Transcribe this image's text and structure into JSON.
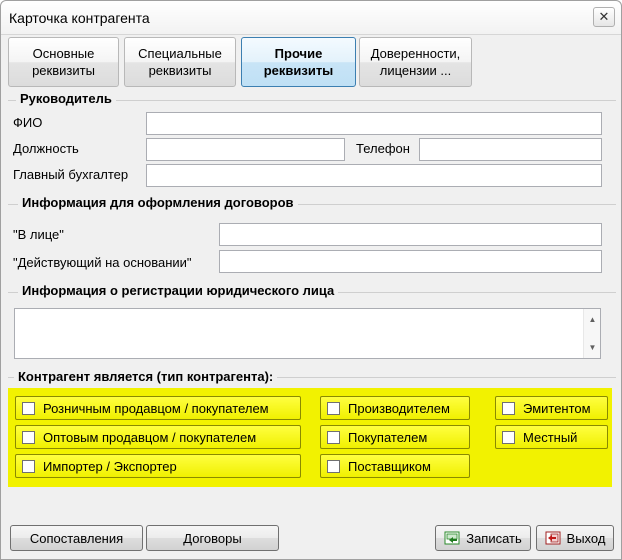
{
  "window": {
    "title": "Карточка контрагента",
    "close_glyph": "✕"
  },
  "tabs": [
    {
      "label": "Основные реквизиты",
      "active": false
    },
    {
      "label": "Специальные реквизиты",
      "active": false
    },
    {
      "label": "Прочие реквизиты",
      "active": true
    },
    {
      "label": "Доверенности, лицензии ...",
      "active": false
    }
  ],
  "director": {
    "section_title": "Руководитель",
    "fio_label": "ФИО",
    "fio_value": "",
    "position_label": "Должность",
    "position_value": "",
    "phone_label": "Телефон",
    "phone_value": "",
    "accountant_label": "Главный бухгалтер",
    "accountant_value": ""
  },
  "contracts": {
    "section_title": "Информация для оформления договоров",
    "in_person_label": "\"В лице\"",
    "in_person_value": "",
    "acting_basis_label": "\"Действующий на основании\"",
    "acting_basis_value": ""
  },
  "registration": {
    "section_title": "Информация о регистрации юридического лица",
    "value": "",
    "scroll_up_glyph": "▲",
    "scroll_down_glyph": "▼"
  },
  "contractor_type": {
    "section_title": "Контрагент является (тип контрагента):",
    "highlight_color": "#f2f200",
    "options": [
      {
        "label": "Розничным продавцом / покупателем",
        "checked": false
      },
      {
        "label": "Оптовым продавцом / покупателем",
        "checked": false
      },
      {
        "label": "Импортер / Экспортер",
        "checked": false
      },
      {
        "label": "Производителем",
        "checked": false
      },
      {
        "label": "Покупателем",
        "checked": false
      },
      {
        "label": "Поставщиком",
        "checked": false
      },
      {
        "label": "Эмитентом",
        "checked": false
      },
      {
        "label": "Местный",
        "checked": false
      }
    ]
  },
  "buttons": {
    "matches_label": "Сопоставления",
    "contracts_label": "Договоры",
    "save_label": "Записать",
    "save_icon": "save-icon",
    "exit_label": "Выход",
    "exit_icon": "exit-icon"
  }
}
